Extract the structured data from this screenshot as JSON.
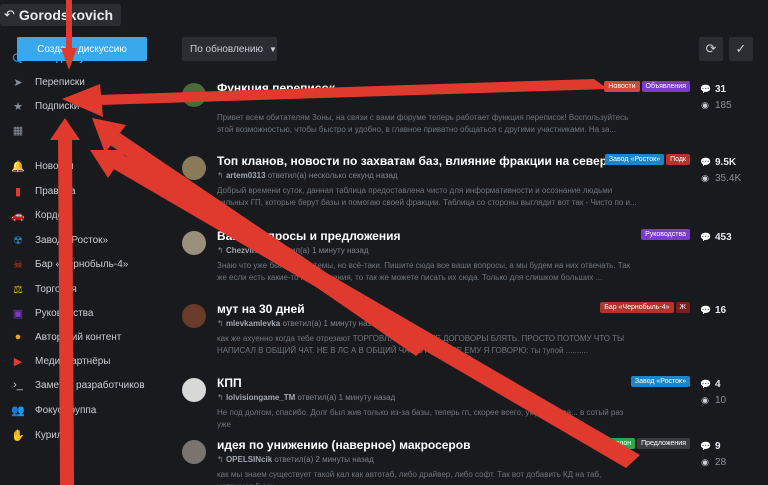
{
  "header": {
    "back_icon": "back-arrow-icon",
    "title": "Gorodskovich"
  },
  "sidebar": {
    "create_label": "Создать дискуссию",
    "items": [
      {
        "label": "Все дискуссии",
        "icon": "chat-bubbles-icon",
        "active": true
      },
      {
        "label": "Переписки",
        "icon": "paper-plane-icon"
      },
      {
        "label": "Подписки",
        "icon": "star-icon"
      },
      {
        "label": "",
        "icon": "grid-icon"
      },
      {
        "label": "Новости",
        "icon": "bell-icon"
      },
      {
        "label": "Правила",
        "icon": "book-icon"
      },
      {
        "label": "Кордон",
        "icon": "car-icon"
      },
      {
        "label": "Завод «Росток»",
        "icon": "radiation-icon"
      },
      {
        "label": "Бар «Чернобыль-4»",
        "icon": "skull-icon"
      },
      {
        "label": "Торговля",
        "icon": "scales-icon"
      },
      {
        "label": "Руководства",
        "icon": "guide-icon"
      },
      {
        "label": "Авторский контент",
        "icon": "bulb-icon"
      },
      {
        "label": "Медиапартнёры",
        "icon": "video-icon"
      },
      {
        "label": "Заметки разработчиков",
        "icon": "terminal-icon"
      },
      {
        "label": "Фокус-группа",
        "icon": "users-icon"
      },
      {
        "label": "Курилка",
        "icon": "hand-icon"
      }
    ]
  },
  "toolbar": {
    "sort_label": "По обновлению",
    "refresh_icon": "refresh-icon",
    "mark_read_icon": "check-icon"
  },
  "discussions": [
    {
      "title": "Функция переписок",
      "meta_user": "",
      "meta_text": "",
      "excerpt": "Привет всем обитателям Зоны, на связи с вами форуме теперь работает функция переписок! Воспользуйтесь этой возможностью, чтобы быстро и удобно, в главное приватно общаться с другими участниками. На за...",
      "tags": [
        {
          "label": "Новости",
          "color": "#d6453a"
        },
        {
          "label": "Объявления",
          "color": "#7b3ad1"
        }
      ],
      "replies": "31",
      "views": "185",
      "avatar_color": "#4a6b3a"
    },
    {
      "title": "Топ кланов, новости по захватам баз, влияние фракции на севере",
      "meta_user": "artem0313",
      "meta_text": "ответил(а) несколько секунд назад",
      "excerpt": "Добрый времени суток, данная таблица предоставлена чисто для информативности и осознание людьми сильных ГП, которые берут базы и помогаю своей фракции. Таблица со стороны выглядит вот так - Чисто по и...",
      "tags": [
        {
          "label": "Завод «Росток»",
          "color": "#1d86c9"
        },
        {
          "label": "Подк",
          "color": "#b1352c"
        }
      ],
      "replies": "9.5K",
      "views": "35.4K",
      "avatar_color": "#8a7a5a"
    },
    {
      "title": "Ваши вопросы и предложения",
      "meta_user": "Chezvirmel",
      "meta_text": "ответил(а) 1 минуту назад",
      "excerpt": "Знаю что уже была такие темы, но всё-таки. Пишите сюда все ваши вопросы, а мы будем на них отвечать. Так же если есть какие-то предложения, то так же можете писать их сюда. Только для слишком больших ...",
      "tags": [
        {
          "label": "Руководства",
          "color": "#7b3ad1"
        }
      ],
      "replies": "453",
      "views": "",
      "avatar_color": "#9a8f7a"
    },
    {
      "title": "мут на 30 дней",
      "meta_user": "mlevkamlevka",
      "meta_text": "ответил(а) 1 минуту назад",
      "excerpt": "как же ахуенно когда тебе отрезают ТОРГОВЛЯ, ОБЩЕНИЕ,ДОГОВОРЫ БЛЯТЬ. ПРОСТО ПОТОМУ ЧТО ТЫ НАПИСАЛ В ОБЩИЙ ЧАТ. НЕ В ЛС А В ОБЩИЙ ЧАТ. ЭТО ЖЕ НЕ ЕМУ Я ГОВОРЮ: ты тупой ..........",
      "tags": [
        {
          "label": "Бар «Чернобыль-4»",
          "color": "#b1352c"
        },
        {
          "label": "Ж",
          "color": "#7a1f1a"
        }
      ],
      "replies": "16",
      "views": "",
      "avatar_color": "#6a3a2a"
    },
    {
      "title": "КПП",
      "meta_user": "lolvisiongame_TM",
      "meta_text": "ответил(а) 1 минуту назад",
      "excerpt": "Не под долгом, спасибо. Долг был жив только из-за базы, теперь гп, скорее всего, умрёт снова... в сотый раз уже",
      "tags": [
        {
          "label": "Завод «Росток»",
          "color": "#1d86c9"
        }
      ],
      "replies": "4",
      "views": "10",
      "avatar_color": "#d8d8d8"
    },
    {
      "title": "идея по унижению (наверное) макросеров",
      "meta_user": "OPELSINcik",
      "meta_text": "ответил(а) 2 минуты назад",
      "excerpt": "как мы знаем существует такой кал как автотаб, либо драйвер, либо софт. Так вот добавить КД на таб, например 5 сек.",
      "tags": [
        {
          "label": "Кордон",
          "color": "#2aa84a"
        },
        {
          "label": "Предложения",
          "color": "#3a3d42"
        }
      ],
      "replies": "9",
      "views": "28",
      "avatar_color": "#7a7470"
    }
  ]
}
